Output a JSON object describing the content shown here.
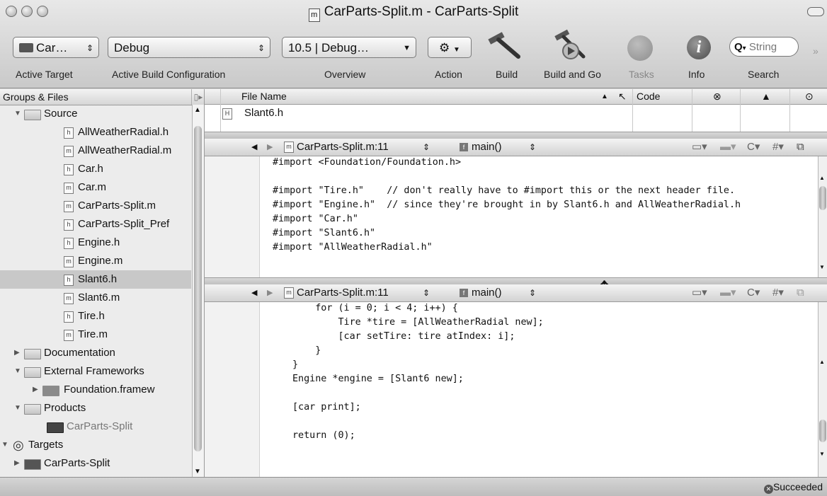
{
  "window": {
    "title": "CarParts-Split.m - CarParts-Split",
    "doc_icon": "m"
  },
  "toolbar": {
    "active_target": "Car…",
    "build_config": "Debug",
    "overview": "10.5 | Debug…",
    "search_placeholder": "String",
    "labels": {
      "active_target": "Active Target",
      "active_build_config": "Active Build Configuration",
      "overview": "Overview",
      "action": "Action",
      "build": "Build",
      "build_and_go": "Build and Go",
      "tasks": "Tasks",
      "info": "Info",
      "search": "Search"
    }
  },
  "sidebar": {
    "header": "Groups & Files",
    "items": [
      {
        "label": "Source",
        "kind": "folder",
        "indent": 1,
        "disclosure": "open"
      },
      {
        "label": "AllWeatherRadial.h",
        "kind": "h",
        "indent": 2
      },
      {
        "label": "AllWeatherRadial.m",
        "kind": "m",
        "indent": 2
      },
      {
        "label": "Car.h",
        "kind": "h",
        "indent": 2
      },
      {
        "label": "Car.m",
        "kind": "m",
        "indent": 2
      },
      {
        "label": "CarParts-Split.m",
        "kind": "m",
        "indent": 2
      },
      {
        "label": "CarParts-Split_Pref",
        "kind": "h",
        "indent": 2
      },
      {
        "label": "Engine.h",
        "kind": "h",
        "indent": 2
      },
      {
        "label": "Engine.m",
        "kind": "m",
        "indent": 2
      },
      {
        "label": "Slant6.h",
        "kind": "h",
        "indent": 2,
        "selected": true
      },
      {
        "label": "Slant6.m",
        "kind": "m",
        "indent": 2
      },
      {
        "label": "Tire.h",
        "kind": "h",
        "indent": 2
      },
      {
        "label": "Tire.m",
        "kind": "m",
        "indent": 2
      },
      {
        "label": "Documentation",
        "kind": "folder",
        "indent": 1,
        "disclosure": "closed"
      },
      {
        "label": "External Frameworks",
        "kind": "folder",
        "indent": 1,
        "disclosure": "open"
      },
      {
        "label": "Foundation.framew",
        "kind": "framework",
        "indent": 2,
        "disclosure": "closed"
      },
      {
        "label": "Products",
        "kind": "folder",
        "indent": 1,
        "disclosure": "open"
      },
      {
        "label": "CarParts-Split",
        "kind": "product",
        "indent": 2,
        "dim": true
      },
      {
        "label": "Targets",
        "kind": "targets",
        "indent": 0,
        "disclosure": "open"
      },
      {
        "label": "CarParts-Split",
        "kind": "target",
        "indent": 1,
        "disclosure": "closed"
      }
    ]
  },
  "file_list": {
    "columns": [
      "File Name",
      "Code"
    ],
    "rows": [
      {
        "name": "Slant6.h",
        "kind": "H"
      }
    ]
  },
  "editor_top": {
    "file": "CarParts-Split.m:11",
    "function": "main()",
    "lines": [
      "#import <Foundation/Foundation.h>",
      "",
      "#import \"Tire.h\"    // don't really have to #import this or the next header file.",
      "#import \"Engine.h\"  // since they're brought in by Slant6.h and AllWeatherRadial.h",
      "#import \"Car.h\"",
      "#import \"Slant6.h\"",
      "#import \"AllWeatherRadial.h\""
    ]
  },
  "editor_bottom": {
    "file": "CarParts-Split.m:11",
    "function": "main()",
    "lines": [
      "    for (i = 0; i < 4; i++) {",
      "        Tire *tire = [AllWeatherRadial new];",
      "        [car setTire: tire atIndex: i];",
      "    }",
      "}",
      "Engine *engine = [Slant6 new];",
      "",
      "[car print];",
      "",
      "return (0);"
    ]
  },
  "status": {
    "text": "Succeeded"
  }
}
